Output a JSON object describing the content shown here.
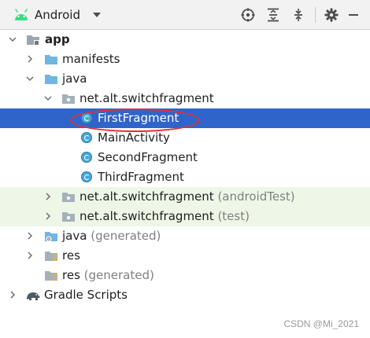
{
  "toolbar": {
    "title": "Android",
    "buttons": [
      "locate-icon",
      "expand-all-icon",
      "collapse-all-icon",
      "gear-icon",
      "hide-icon"
    ]
  },
  "tree": {
    "app": "app",
    "manifests": "manifests",
    "java": "java",
    "package": "net.alt.switchfragment",
    "files": [
      "FirstFragment",
      "MainActivity",
      "SecondFragment",
      "ThirdFragment"
    ],
    "package_android_test": "net.alt.switchfragment",
    "android_test_suffix": "(androidTest)",
    "package_test": "net.alt.switchfragment",
    "test_suffix": "(test)",
    "java_generated": "java",
    "generated_suffix": "(generated)",
    "res": "res",
    "res_generated": "res",
    "res_generated_suffix": "(generated)",
    "gradle_scripts": "Gradle Scripts"
  },
  "selected_item": "FirstFragment",
  "watermark": "CSDN @Mi_2021",
  "colors": {
    "selection": "#2f65ca",
    "test_background": "#eef6e7",
    "annotation": "#e0303a",
    "android_green": "#3ddc84"
  }
}
